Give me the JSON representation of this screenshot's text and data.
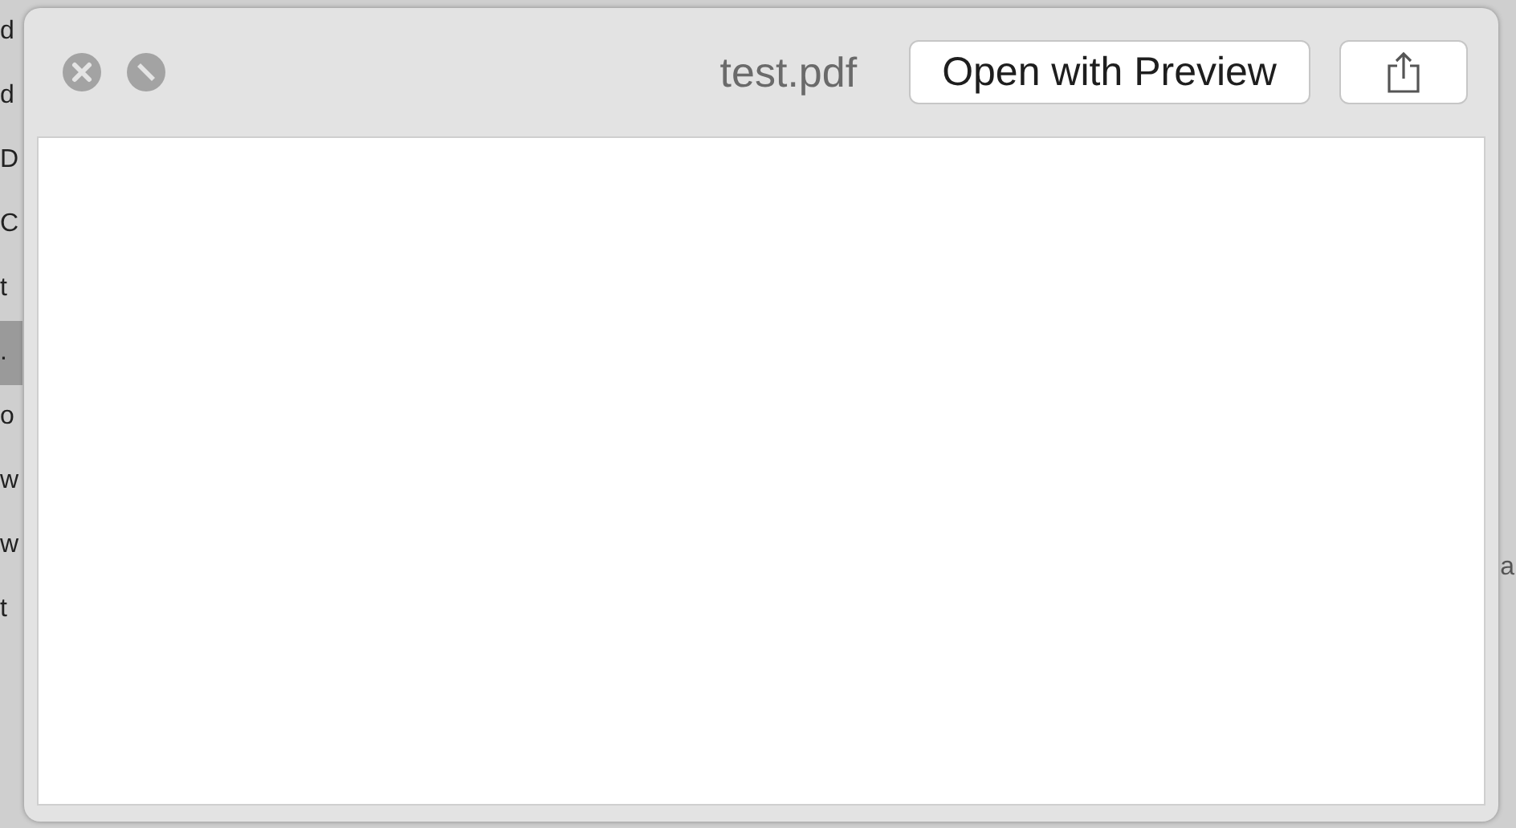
{
  "background_list": [
    {
      "label": "d",
      "selected": false
    },
    {
      "label": "d",
      "selected": false
    },
    {
      "label": "D",
      "selected": false
    },
    {
      "label": "C",
      "selected": false
    },
    {
      "label": "t",
      "selected": false
    },
    {
      "label": ".",
      "selected": true
    },
    {
      "label": "o",
      "selected": false
    },
    {
      "label": "w",
      "selected": false
    },
    {
      "label": "w",
      "selected": false
    },
    {
      "label": "t",
      "selected": false
    }
  ],
  "background_right_text": "a",
  "window": {
    "title": "test.pdf",
    "open_button": "Open with Preview"
  }
}
